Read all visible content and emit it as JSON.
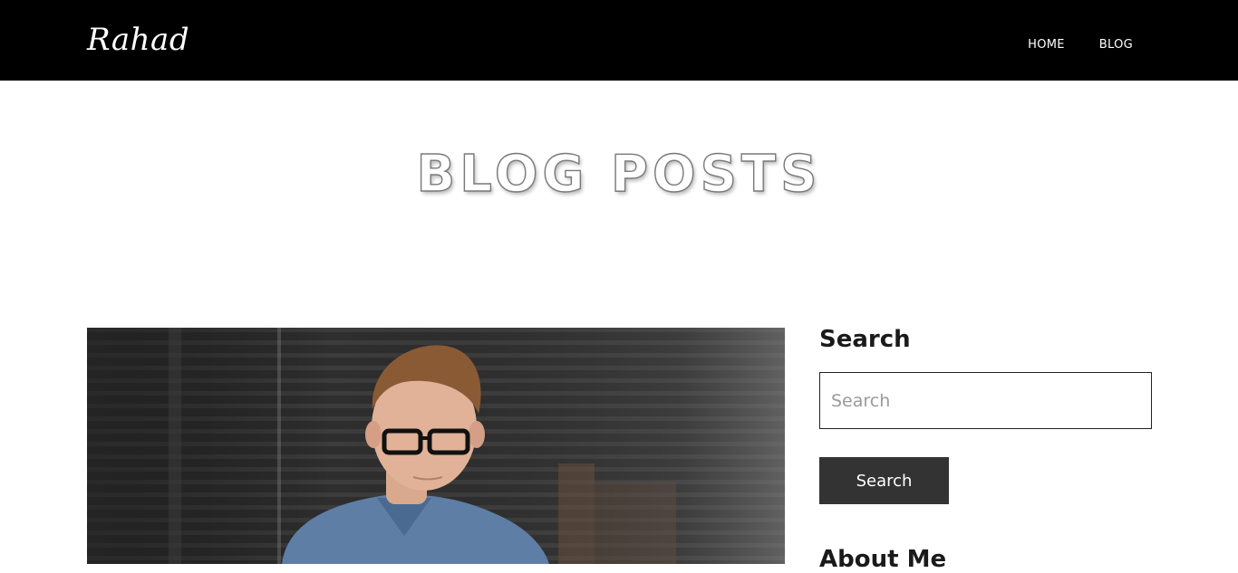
{
  "header": {
    "brand": "Rahad",
    "nav": [
      {
        "label": "HOME"
      },
      {
        "label": "BLOG"
      }
    ]
  },
  "hero": {
    "title": "BLOG POSTS"
  },
  "post": {
    "image": "man-with-glasses-photo"
  },
  "sidebar": {
    "search": {
      "title": "Search",
      "placeholder": "Search",
      "value": "",
      "button_label": "Search"
    },
    "about": {
      "title": "About Me"
    }
  },
  "colors": {
    "header_bg": "#000000",
    "button_bg": "#333333",
    "text_dark": "#1a1a1a"
  }
}
